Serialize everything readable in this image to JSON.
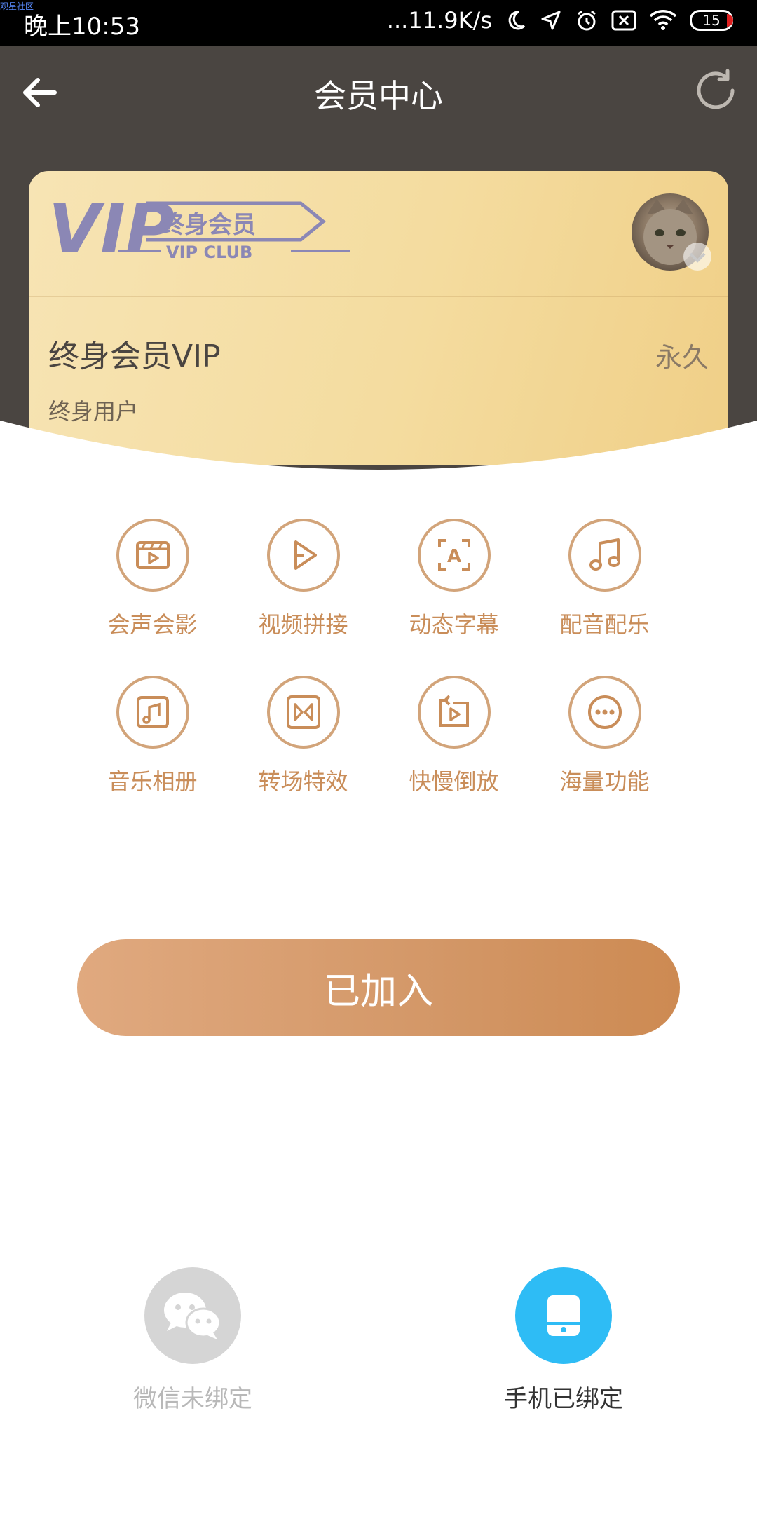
{
  "status_bar": {
    "time": "晚上10:53",
    "network_speed": "...11.9K/s",
    "battery": "15",
    "watermark": "观星社区"
  },
  "header": {
    "title": "会员中心",
    "back_icon": "arrow-left-icon",
    "refresh_icon": "refresh-icon",
    "background": "#4a4541"
  },
  "card": {
    "logo_text": "VIP",
    "badge_title": "终身会员",
    "badge_subtitle": "VIP CLUB",
    "plan_name": "终身会员VIP",
    "plan_term": "永久",
    "user_type": "终身用户"
  },
  "features": [
    {
      "label": "会声会影",
      "icon": "video-clip-icon"
    },
    {
      "label": "视频拼接",
      "icon": "play-icon"
    },
    {
      "label": "动态字幕",
      "icon": "caption-icon"
    },
    {
      "label": "配音配乐",
      "icon": "music-note-icon"
    },
    {
      "label": "音乐相册",
      "icon": "music-album-icon"
    },
    {
      "label": "转场特效",
      "icon": "transition-icon"
    },
    {
      "label": "快慢倒放",
      "icon": "reverse-play-icon"
    },
    {
      "label": "海量功能",
      "icon": "more-icon"
    }
  ],
  "action": {
    "joined_label": "已加入"
  },
  "bindings": {
    "wechat": {
      "label": "微信未绑定",
      "icon": "wechat-icon"
    },
    "phone": {
      "label": "手机已绑定",
      "icon": "phone-icon"
    }
  },
  "colors": {
    "accent": "#c98d59",
    "phone_bound": "#2ebcf5",
    "unbound_gray": "#d5d5d5"
  }
}
